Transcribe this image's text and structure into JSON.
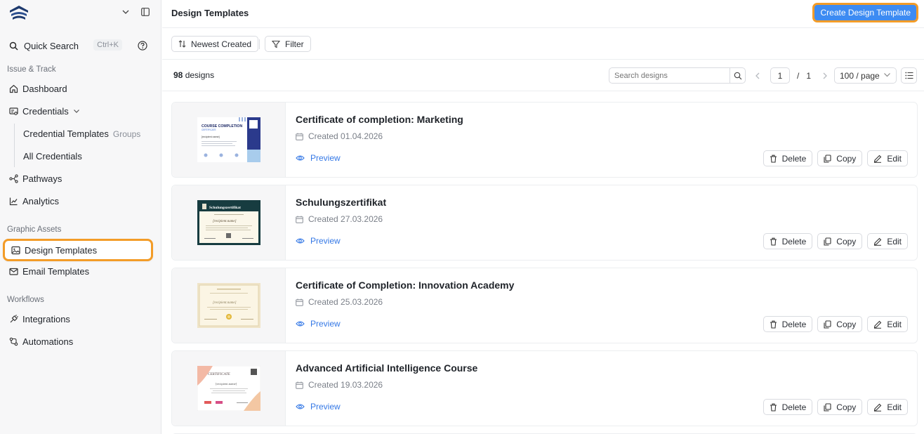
{
  "sidebar": {
    "quick_search": {
      "label": "Quick Search",
      "shortcut": "Ctrl+K"
    },
    "sections": [
      {
        "label": "Issue & Track"
      },
      {
        "label": "Graphic Assets"
      },
      {
        "label": "Workflows"
      }
    ],
    "items": {
      "dashboard": "Dashboard",
      "credentials": "Credentials",
      "credential_templates": "Credential Templates",
      "groups": "Groups",
      "all_credentials": "All Credentials",
      "pathways": "Pathways",
      "analytics": "Analytics",
      "design_templates": "Design Templates",
      "email_templates": "Email Templates",
      "integrations": "Integrations",
      "automations": "Automations"
    }
  },
  "header": {
    "title": "Design Templates",
    "create_label": "Create Design Template"
  },
  "toolbar": {
    "sort_label": "Newest Created",
    "filter_label": "Filter"
  },
  "list": {
    "count": "98",
    "count_suffix": "designs",
    "search_placeholder": "Search designs",
    "page": "1",
    "page_sep": "/",
    "total_pages": "1",
    "page_size": "100 / page"
  },
  "designs": [
    {
      "title": "Certificate of completion: Marketing",
      "created": "Created 01.04.2026"
    },
    {
      "title": "Schulungszertifikat",
      "created": "Created 27.03.2026"
    },
    {
      "title": "Certificate of Completion: Innovation Academy",
      "created": "Created 25.03.2026"
    },
    {
      "title": "Advanced Artificial Intelligence Course",
      "created": "Created 19.03.2026"
    }
  ],
  "card_actions": {
    "preview": "Preview",
    "delete": "Delete",
    "copy": "Copy",
    "edit": "Edit"
  },
  "thumbnails": {
    "t1": {
      "heading": "COURSE COMPLETION",
      "sub": "CERTIFICATE",
      "name": "[recipient.name]"
    },
    "t2": {
      "heading": "Schulungszertifikat",
      "name": "[recipient.name]"
    },
    "t3": {
      "name": "[recipient.name]"
    },
    "t4": {
      "heading": "CERTIFICATE",
      "name": "[recipient.name]"
    }
  },
  "colors": {
    "accent": "#3d8bf2",
    "highlight": "#f39c28",
    "link": "#3478e6"
  }
}
